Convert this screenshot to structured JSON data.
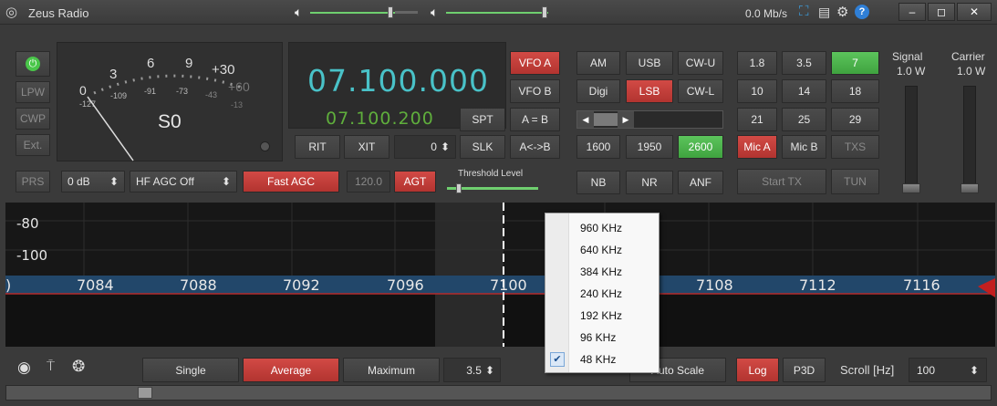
{
  "title": {
    "app_name": "Zeus Radio",
    "rate": "0.0 Mb/s",
    "minimize": "–",
    "maximize": "◻",
    "close": "✕"
  },
  "left": {
    "lpw": "LPW",
    "cwp": "CWP",
    "ext": "Ext.",
    "prs": "PRS",
    "gain": "0 dB",
    "agc_select": "HF AGC Off",
    "fast_agc": "Fast AGC",
    "agc_value": "120.0",
    "agt": "AGT",
    "threshold_label": "Threshold Level"
  },
  "meter": {
    "scale_s": [
      "3",
      "6",
      "9",
      "+30"
    ],
    "scale_db": [
      "-109",
      "-91",
      "-73",
      "-43",
      "-13"
    ],
    "left0": "0",
    "left127": "-127",
    "plus60": "+60",
    "reading": "S0"
  },
  "vfo": {
    "main": "07.100.000",
    "sub": "07.100.200",
    "offset": "0",
    "vfo_a": "VFO A",
    "vfo_b": "VFO B",
    "spt": "SPT",
    "a_eq_b": "A = B",
    "slk": "SLK",
    "a_swap_b": "A<->B",
    "rit": "RIT",
    "xit": "XIT"
  },
  "modes": {
    "am": "AM",
    "usb": "USB",
    "cwu": "CW-U",
    "digi": "Digi",
    "lsb": "LSB",
    "cwl": "CW-L",
    "f1600": "1600",
    "f1950": "1950",
    "f2600": "2600",
    "nb": "NB",
    "nr": "NR",
    "anf": "ANF"
  },
  "bands": {
    "row1": [
      "1.8",
      "3.5",
      "7"
    ],
    "row2": [
      "10",
      "14",
      "18"
    ],
    "row3": [
      "21",
      "25",
      "29"
    ],
    "mic_a": "Mic A",
    "mic_b": "Mic B",
    "txs": "TXS",
    "start_tx": "Start TX",
    "tun": "TUN"
  },
  "power": {
    "signal_label": "Signal",
    "signal_value": "1.0 W",
    "carrier_label": "Carrier",
    "carrier_value": "1.0 W"
  },
  "spectrum": {
    "db_labels": [
      "-80",
      "-100"
    ],
    "freq_labels": [
      "7084",
      "7088",
      "7092",
      "7096",
      "7100",
      "7108",
      "7112",
      "7116"
    ],
    "left_partial": ")"
  },
  "menu": {
    "items": [
      "960 KHz",
      "640 KHz",
      "384 KHz",
      "240 KHz",
      "192 KHz",
      "96 KHz",
      "48 KHz"
    ],
    "checked_index": 6
  },
  "bottom": {
    "single": "Single",
    "average": "Average",
    "maximum": "Maximum",
    "avg_value": "3.5",
    "auto_scale": "Auto Scale",
    "log": "Log",
    "p3d": "P3D",
    "scroll_label": "Scroll [Hz]",
    "scroll_value": "100"
  },
  "colors": {
    "accent_red": "#c23b36",
    "accent_green": "#4cbb4c",
    "vfo_cyan": "#49c2c8",
    "sub_green": "#5fae3c"
  }
}
